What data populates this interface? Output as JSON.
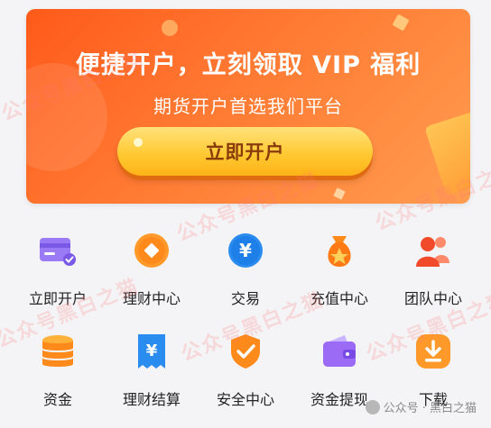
{
  "banner": {
    "title": "便捷开户，立刻领取 VIP 福利",
    "subtitle": "期货开户首选我们平台",
    "button_label": "立即开户",
    "gradient_start": "#ff5a1a",
    "gradient_end": "#ff9d4f",
    "button_color": "#ffc72e"
  },
  "grid": {
    "items": [
      {
        "label": "立即开户",
        "icon": "card-check-icon"
      },
      {
        "label": "理财中心",
        "icon": "coin-icon"
      },
      {
        "label": "交易",
        "icon": "yen-icon"
      },
      {
        "label": "充值中心",
        "icon": "money-bag-icon"
      },
      {
        "label": "团队中心",
        "icon": "team-icon"
      },
      {
        "label": "资金",
        "icon": "coin-stack-icon"
      },
      {
        "label": "理财结算",
        "icon": "receipt-icon"
      },
      {
        "label": "安全中心",
        "icon": "shield-check-icon"
      },
      {
        "label": "资金提现",
        "icon": "wallet-icon"
      },
      {
        "label": "下载",
        "icon": "download-icon"
      }
    ]
  },
  "watermark": {
    "text": "公众号黑白之猫",
    "footer": "公众号 · 黑白之猫"
  }
}
